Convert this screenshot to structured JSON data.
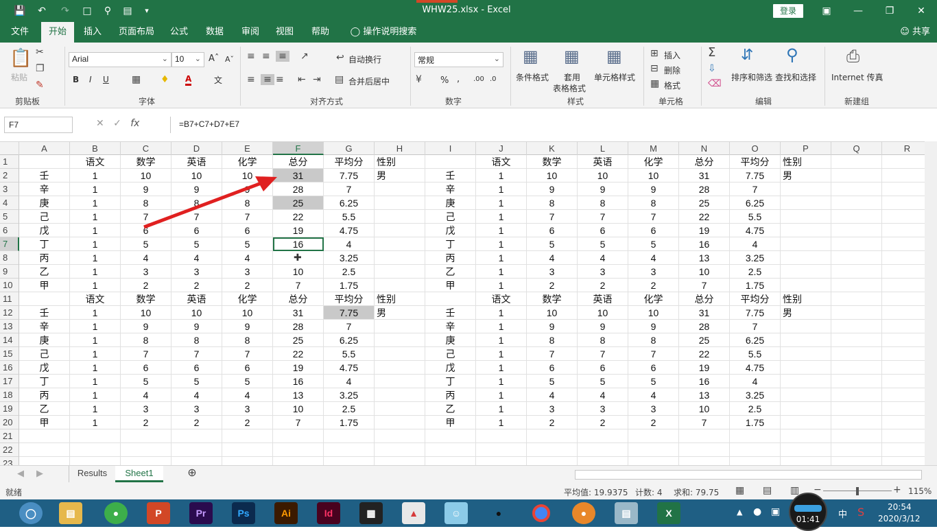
{
  "titlebar": {
    "title": "WHW25.xlsx  -  Excel",
    "login": "登录"
  },
  "tabs": [
    "文件",
    "开始",
    "插入",
    "页面布局",
    "公式",
    "数据",
    "审阅",
    "视图",
    "帮助"
  ],
  "tell_me": "操作说明搜索",
  "share": "共享",
  "ribbon": {
    "paste": "粘贴",
    "font_name": "Arial",
    "font_size": "10",
    "wrap": "自动换行",
    "merge": "合并后居中",
    "number_format": "常规",
    "cond_format": "条件格式",
    "table_format": "套用\n表格格式",
    "cell_style": "单元格样式",
    "insert": "插入",
    "delete": "删除",
    "format": "格式",
    "sort_filter": "排序和筛选",
    "find_select": "查找和选择",
    "internet_fax": "Internet 传真",
    "groups": {
      "clipboard": "剪贴板",
      "font": "字体",
      "alignment": "对齐方式",
      "number": "数字",
      "styles": "样式",
      "cells": "单元格",
      "editing": "编辑",
      "newgroup": "新建组"
    }
  },
  "formula_bar": {
    "name_box": "F7",
    "formula": "=B7+C7+D7+E7"
  },
  "columns": [
    "A",
    "B",
    "C",
    "D",
    "E",
    "F",
    "G",
    "H",
    "I",
    "J",
    "K",
    "L",
    "M",
    "N",
    "O",
    "P",
    "Q",
    "R"
  ],
  "rows": [
    [
      "",
      "语文",
      "数学",
      "英语",
      "化学",
      "总分",
      "平均分",
      "性别",
      "",
      "语文",
      "数学",
      "英语",
      "化学",
      "总分",
      "平均分",
      "性别",
      "",
      ""
    ],
    [
      "壬",
      "1",
      "10",
      "10",
      "10",
      "31",
      "7.75",
      "男",
      "壬",
      "1",
      "10",
      "10",
      "10",
      "31",
      "7.75",
      "男",
      "",
      ""
    ],
    [
      "辛",
      "1",
      "9",
      "9",
      "9",
      "28",
      "7",
      "",
      "辛",
      "1",
      "9",
      "9",
      "9",
      "28",
      "7",
      "",
      "",
      ""
    ],
    [
      "庚",
      "1",
      "8",
      "8",
      "8",
      "25",
      "6.25",
      "",
      "庚",
      "1",
      "8",
      "8",
      "8",
      "25",
      "6.25",
      "",
      "",
      ""
    ],
    [
      "己",
      "1",
      "7",
      "7",
      "7",
      "22",
      "5.5",
      "",
      "己",
      "1",
      "7",
      "7",
      "7",
      "22",
      "5.5",
      "",
      "",
      ""
    ],
    [
      "戊",
      "1",
      "6",
      "6",
      "6",
      "19",
      "4.75",
      "",
      "戊",
      "1",
      "6",
      "6",
      "6",
      "19",
      "4.75",
      "",
      "",
      ""
    ],
    [
      "丁",
      "1",
      "5",
      "5",
      "5",
      "16",
      "4",
      "",
      "丁",
      "1",
      "5",
      "5",
      "5",
      "16",
      "4",
      "",
      "",
      ""
    ],
    [
      "丙",
      "1",
      "4",
      "4",
      "4",
      "",
      "3.25",
      "",
      "丙",
      "1",
      "4",
      "4",
      "4",
      "13",
      "3.25",
      "",
      "",
      ""
    ],
    [
      "乙",
      "1",
      "3",
      "3",
      "3",
      "10",
      "2.5",
      "",
      "乙",
      "1",
      "3",
      "3",
      "3",
      "10",
      "2.5",
      "",
      "",
      ""
    ],
    [
      "甲",
      "1",
      "2",
      "2",
      "2",
      "7",
      "1.75",
      "",
      "甲",
      "1",
      "2",
      "2",
      "2",
      "7",
      "1.75",
      "",
      "",
      ""
    ],
    [
      "",
      "语文",
      "数学",
      "英语",
      "化学",
      "总分",
      "平均分",
      "性别",
      "",
      "语文",
      "数学",
      "英语",
      "化学",
      "总分",
      "平均分",
      "性别",
      "",
      ""
    ],
    [
      "壬",
      "1",
      "10",
      "10",
      "10",
      "31",
      "7.75",
      "男",
      "壬",
      "1",
      "10",
      "10",
      "10",
      "31",
      "7.75",
      "男",
      "",
      ""
    ],
    [
      "辛",
      "1",
      "9",
      "9",
      "9",
      "28",
      "7",
      "",
      "辛",
      "1",
      "9",
      "9",
      "9",
      "28",
      "7",
      "",
      "",
      ""
    ],
    [
      "庚",
      "1",
      "8",
      "8",
      "8",
      "25",
      "6.25",
      "",
      "庚",
      "1",
      "8",
      "8",
      "8",
      "25",
      "6.25",
      "",
      "",
      ""
    ],
    [
      "己",
      "1",
      "7",
      "7",
      "7",
      "22",
      "5.5",
      "",
      "己",
      "1",
      "7",
      "7",
      "7",
      "22",
      "5.5",
      "",
      "",
      ""
    ],
    [
      "戊",
      "1",
      "6",
      "6",
      "6",
      "19",
      "4.75",
      "",
      "戊",
      "1",
      "6",
      "6",
      "6",
      "19",
      "4.75",
      "",
      "",
      ""
    ],
    [
      "丁",
      "1",
      "5",
      "5",
      "5",
      "16",
      "4",
      "",
      "丁",
      "1",
      "5",
      "5",
      "5",
      "16",
      "4",
      "",
      "",
      ""
    ],
    [
      "丙",
      "1",
      "4",
      "4",
      "4",
      "13",
      "3.25",
      "",
      "丙",
      "1",
      "4",
      "4",
      "4",
      "13",
      "3.25",
      "",
      "",
      ""
    ],
    [
      "乙",
      "1",
      "3",
      "3",
      "3",
      "10",
      "2.5",
      "",
      "乙",
      "1",
      "3",
      "3",
      "3",
      "10",
      "2.5",
      "",
      "",
      ""
    ],
    [
      "甲",
      "1",
      "2",
      "2",
      "2",
      "7",
      "1.75",
      "",
      "甲",
      "1",
      "2",
      "2",
      "2",
      "7",
      "1.75",
      "",
      "",
      ""
    ],
    [
      "",
      "",
      "",
      "",
      "",
      "",
      "",
      "",
      "",
      "",
      "",
      "",
      "",
      "",
      "",
      "",
      "",
      ""
    ],
    [
      "",
      "",
      "",
      "",
      "",
      "",
      "",
      "",
      "",
      "",
      "",
      "",
      "",
      "",
      "",
      "",
      "",
      ""
    ],
    [
      "",
      "",
      "",
      "",
      "",
      "",
      "",
      "",
      "",
      "",
      "",
      "",
      "",
      "",
      "",
      "",
      "",
      ""
    ]
  ],
  "sheets": [
    "Results",
    "Sheet1"
  ],
  "status": {
    "ready": "就绪",
    "average": "平均值: 19.9375",
    "count": "计数: 4",
    "sum": "求和: 79.75",
    "zoom": "115%"
  },
  "taskbar": {
    "time": "20:54",
    "date": "2020/3/12",
    "ime": "中",
    "overlay_time": "01:41"
  },
  "colors": {
    "excel_green": "#217346",
    "taskbar": "#1f5f84",
    "arrow": "#e02020"
  }
}
